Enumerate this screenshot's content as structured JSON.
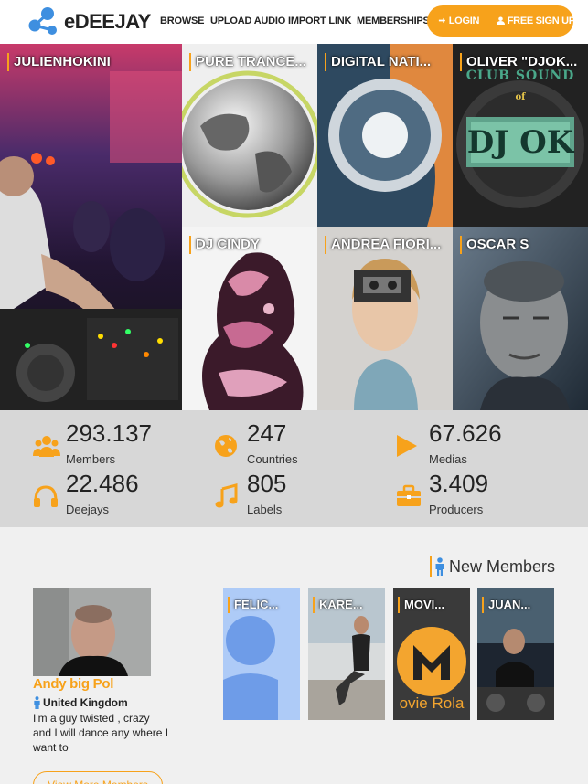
{
  "brand": {
    "name": "eDEEJAY",
    "accent": "#f7a21b",
    "logo_color": "#3e8fe0"
  },
  "nav": {
    "links": [
      "BROWSE",
      "UPLOAD AUDIO",
      "IMPORT LINK",
      "MEMBERSHIPS"
    ],
    "login": "LOGIN",
    "signup": "FREE SIGN UP",
    "login_icon": "sign-in-icon",
    "signup_icon": "user-icon"
  },
  "featured_artists": [
    {
      "name": "JULIENHOKINI"
    },
    {
      "name": "PURE TRANCE..."
    },
    {
      "name": "DIGITAL NATI..."
    },
    {
      "name": "OLIVER \"DJOK..."
    },
    {
      "name": "DJ CINDY"
    },
    {
      "name": "ANDREA FIORI..."
    },
    {
      "name": "OSCAR S"
    }
  ],
  "tile_text": {
    "club_sound": "CLUB SOUND",
    "of": "of",
    "dj_ok": "DJ OK"
  },
  "stats": [
    {
      "value": "293.137",
      "label": "Members",
      "icon": "users-icon"
    },
    {
      "value": "247",
      "label": "Countries",
      "icon": "globe-icon"
    },
    {
      "value": "67.626",
      "label": "Medias",
      "icon": "play-icon"
    },
    {
      "value": "22.486",
      "label": "Deejays",
      "icon": "headphones-icon"
    },
    {
      "value": "805",
      "label": "Labels",
      "icon": "music-note-icon"
    },
    {
      "value": "3.409",
      "label": "Producers",
      "icon": "briefcase-icon"
    }
  ],
  "new_members": {
    "title": "New Members",
    "featured": {
      "name": "Andy big Pol",
      "country": "United Kingdom",
      "bio": "I'm a guy twisted , crazy and I will dance any where I want to"
    },
    "view_more": "View More Members",
    "cards": [
      {
        "name": "FELIC..."
      },
      {
        "name": "KARE..."
      },
      {
        "name": "MOVI..."
      },
      {
        "name": "JUAN..."
      }
    ],
    "card_text": {
      "movie_rola": "ovie Rola"
    }
  }
}
